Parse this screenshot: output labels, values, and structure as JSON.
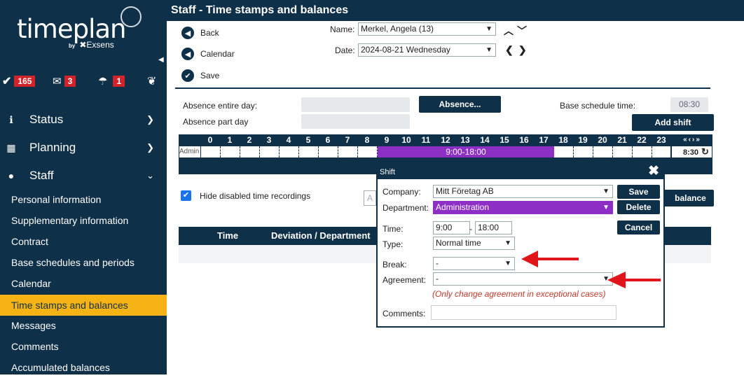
{
  "logo": {
    "name": "timeplan",
    "by": "by",
    "brand": "Exsens"
  },
  "badges": [
    {
      "icon": "check-icon",
      "count": "165"
    },
    {
      "icon": "mail-icon",
      "count": "3"
    },
    {
      "icon": "umbrella-icon",
      "count": "1"
    },
    {
      "icon": "owl-icon",
      "count": ""
    }
  ],
  "nav": {
    "status": "Status",
    "planning": "Planning",
    "staff": "Staff",
    "sub": [
      "Personal information",
      "Supplementary information",
      "Contract",
      "Base schedules and periods",
      "Calendar",
      "Time stamps and balances",
      "Messages",
      "Comments",
      "Accumulated balances"
    ]
  },
  "header": {
    "title": "Staff - Time stamps and balances"
  },
  "toolbar": {
    "back": "Back",
    "calendar": "Calendar",
    "save": "Save"
  },
  "filters": {
    "name_label": "Name:",
    "name_value": "Merkel, Angela (13)",
    "date_label": "Date:",
    "date_value": "2024-08-21 Wednesday"
  },
  "absence": {
    "entire_day": "Absence entire day:",
    "part_day": "Absence part day",
    "button": "Absence...",
    "base_schedule_label": "Base schedule time:",
    "base_schedule_value": "08:30",
    "add_shift": "Add shift"
  },
  "timeline": {
    "hours": [
      "0",
      "1",
      "2",
      "3",
      "4",
      "5",
      "6",
      "7",
      "8",
      "9",
      "10",
      "11",
      "12",
      "13",
      "14",
      "15",
      "16",
      "17",
      "18",
      "19",
      "20",
      "21",
      "22",
      "23"
    ],
    "row_label": "Admin",
    "shift": "9:00-18:00",
    "total": "8:30"
  },
  "hide_disabled": "Hide disabled time recordings",
  "balance_btn": "balance",
  "table": {
    "col_time": "Time",
    "col_deviation": "Deviation / Department"
  },
  "dialog": {
    "title": "Shift",
    "company_label": "Company:",
    "company_value": "Mitt Företag AB",
    "department_label": "Department:",
    "department_value": "Administration",
    "time_label": "Time:",
    "time_from": "9:00",
    "time_sep": "-",
    "time_to": "18:00",
    "type_label": "Type:",
    "type_value": "Normal time",
    "break_label": "Break:",
    "break_value": "-",
    "agreement_label": "Agreement:",
    "agreement_value": "-",
    "agreement_note": "(Only change agreement in exceptional cases)",
    "comments_label": "Comments:",
    "save": "Save",
    "delete": "Delete",
    "cancel": "Cancel"
  },
  "colors": {
    "navy": "#0f3049",
    "accent": "#f5b316",
    "purple": "#8d2fc4",
    "badge_red": "#d2232a",
    "arrow_red": "#e0151b"
  }
}
